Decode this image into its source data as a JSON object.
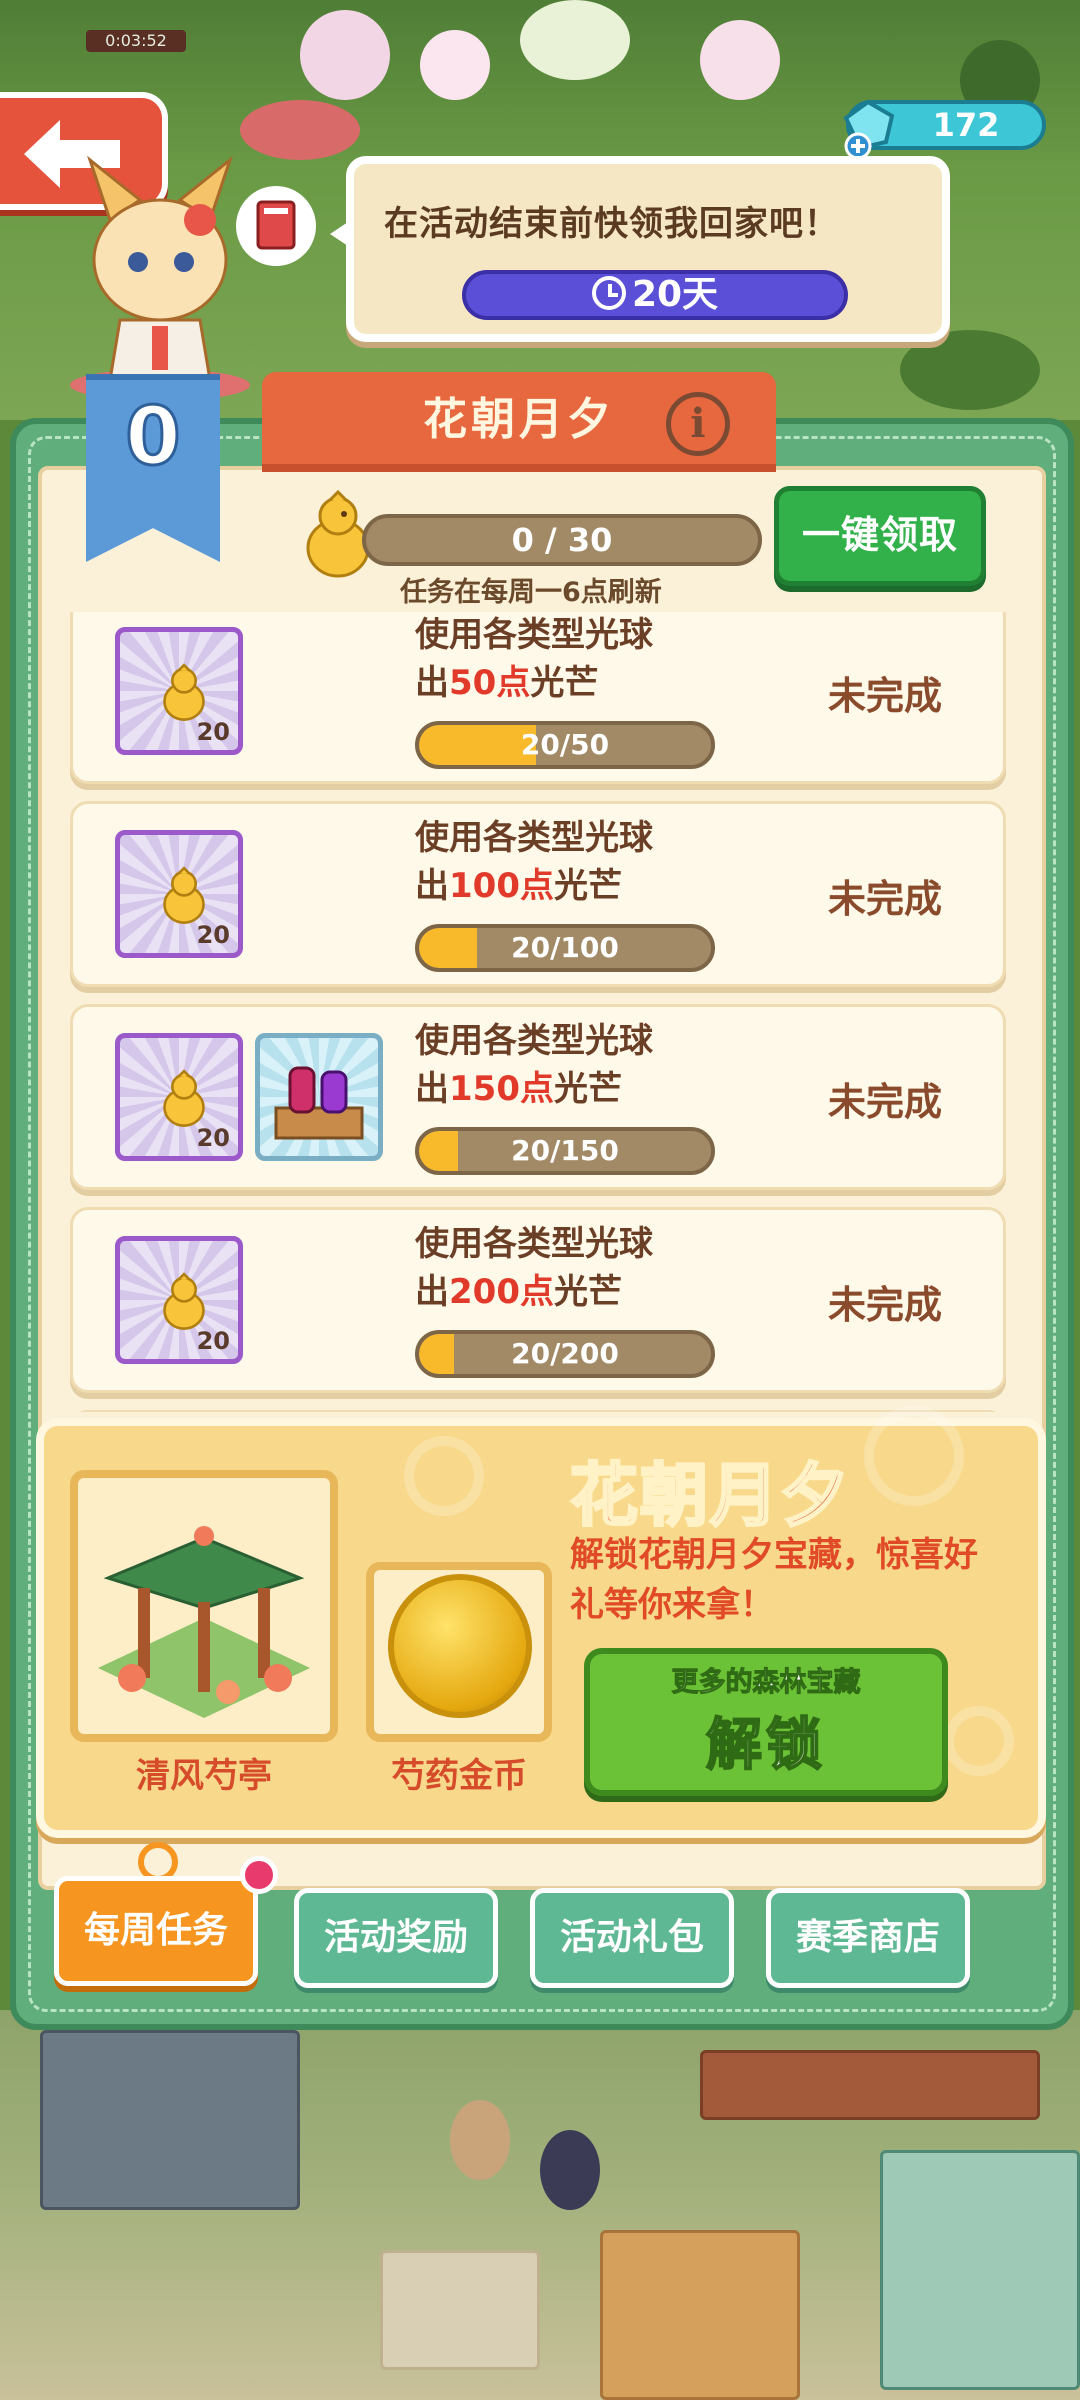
{
  "hud": {
    "gem_count": "172",
    "top_timer": "0:03:52"
  },
  "speech": {
    "text": "在活动结束前快领我回家吧！",
    "days_left": "20天"
  },
  "panel": {
    "title": "花朝月夕",
    "level": "0",
    "progress_text": "0 / 30",
    "refresh_text": "任务在每周一6点刷新",
    "claim_all_label": "一键领取"
  },
  "tasks": [
    {
      "line1": "使用各类型光球",
      "prefix": "出",
      "amount": "50点",
      "suffix": "光芒",
      "reward_qty": "20",
      "progress": "20/50",
      "progress_fraction": 0.4,
      "status": "未完成",
      "has_bottle": false
    },
    {
      "line1": "使用各类型光球",
      "prefix": "出",
      "amount": "100点",
      "suffix": "光芒",
      "reward_qty": "20",
      "progress": "20/100",
      "progress_fraction": 0.2,
      "status": "未完成",
      "has_bottle": false
    },
    {
      "line1": "使用各类型光球",
      "prefix": "出",
      "amount": "150点",
      "suffix": "光芒",
      "reward_qty": "20",
      "progress": "20/150",
      "progress_fraction": 0.133,
      "status": "未完成",
      "has_bottle": true
    },
    {
      "line1": "使用各类型光球",
      "prefix": "出",
      "amount": "200点",
      "suffix": "光芒",
      "reward_qty": "20",
      "progress": "20/200",
      "progress_fraction": 0.1,
      "status": "未完成",
      "has_bottle": false
    }
  ],
  "treasure": {
    "title": "花朝月夕",
    "description": "解锁花朝月夕宝藏，惊喜好礼等你来拿！",
    "pavilion_label": "清风芍亭",
    "coin_label": "芍药金币",
    "unlock_sub": "更多的森林宝藏",
    "unlock_main": "解锁"
  },
  "tabs": [
    "每周任务",
    "活动奖励",
    "活动礼包",
    "赛季商店"
  ],
  "colors": {
    "panel_green": "#5fae7c",
    "accent_orange": "#f6951f",
    "claim_green": "#32b14a",
    "highlight_red": "#e23a2a"
  }
}
